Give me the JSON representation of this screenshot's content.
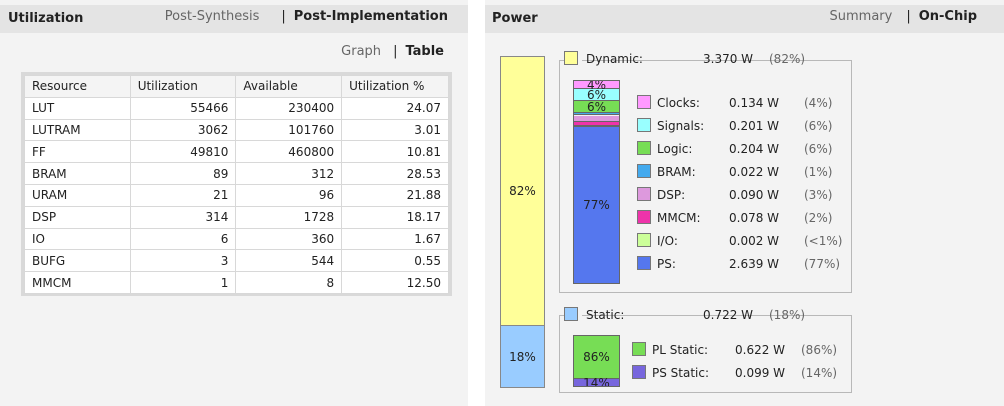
{
  "utilization": {
    "title": "Utilization",
    "tabs": [
      "Post-Synthesis",
      "Post-Implementation"
    ],
    "active_tab": "Post-Implementation",
    "view_tabs": [
      "Graph",
      "Table"
    ],
    "active_view": "Table",
    "table": {
      "headers": [
        "Resource",
        "Utilization",
        "Available",
        "Utilization %"
      ],
      "rows": [
        [
          "LUT",
          "55466",
          "230400",
          "24.07"
        ],
        [
          "LUTRAM",
          "3062",
          "101760",
          "3.01"
        ],
        [
          "FF",
          "49810",
          "460800",
          "10.81"
        ],
        [
          "BRAM",
          "89",
          "312",
          "28.53"
        ],
        [
          "URAM",
          "21",
          "96",
          "21.88"
        ],
        [
          "DSP",
          "314",
          "1728",
          "18.17"
        ],
        [
          "IO",
          "6",
          "360",
          "1.67"
        ],
        [
          "BUFG",
          "3",
          "544",
          "0.55"
        ],
        [
          "MMCM",
          "1",
          "8",
          "12.50"
        ]
      ]
    }
  },
  "power": {
    "title": "Power",
    "tabs": [
      "Summary",
      "On-Chip"
    ],
    "active_tab": "On-Chip",
    "dynamic": {
      "label": "Dynamic:",
      "value": "3.370 W",
      "pct": "(82%)",
      "bar_pct": "82%",
      "color": "#ffff99",
      "fraction": 0.82,
      "items": [
        {
          "label": "Clocks:",
          "value": "0.134 W",
          "pct": "(4%)",
          "seg_label": "4%",
          "color": "#ff99ff",
          "fraction": 0.04
        },
        {
          "label": "Signals:",
          "value": "0.201 W",
          "pct": "(6%)",
          "seg_label": "6%",
          "color": "#99ffff",
          "fraction": 0.06
        },
        {
          "label": "Logic:",
          "value": "0.204 W",
          "pct": "(6%)",
          "seg_label": "6%",
          "color": "#77dd55",
          "fraction": 0.06
        },
        {
          "label": "BRAM:",
          "value": "0.022 W",
          "pct": "(1%)",
          "seg_label": "",
          "color": "#44aaee",
          "fraction": 0.01
        },
        {
          "label": "DSP:",
          "value": "0.090 W",
          "pct": "(3%)",
          "seg_label": "",
          "color": "#dd99dd",
          "fraction": 0.03
        },
        {
          "label": "MMCM:",
          "value": "0.078 W",
          "pct": "(2%)",
          "seg_label": "",
          "color": "#ee33aa",
          "fraction": 0.02
        },
        {
          "label": "I/O:",
          "value": "0.002 W",
          "pct": "(<1%)",
          "seg_label": "",
          "color": "#ccff99",
          "fraction": 0.005
        },
        {
          "label": "PS:",
          "value": "2.639 W",
          "pct": "(77%)",
          "seg_label": "77%",
          "color": "#5577ee",
          "fraction": 0.77
        }
      ]
    },
    "static": {
      "label": "Static:",
      "value": "0.722 W",
      "pct": "(18%)",
      "bar_pct": "18%",
      "color": "#99ccff",
      "fraction": 0.18,
      "items": [
        {
          "label": "PL Static:",
          "value": "0.622 W",
          "pct": "(86%)",
          "seg_label": "86%",
          "color": "#77dd55",
          "fraction": 0.86
        },
        {
          "label": "PS Static:",
          "value": "0.099 W",
          "pct": "(14%)",
          "seg_label": "14%",
          "color": "#7766dd",
          "fraction": 0.14
        }
      ]
    }
  }
}
